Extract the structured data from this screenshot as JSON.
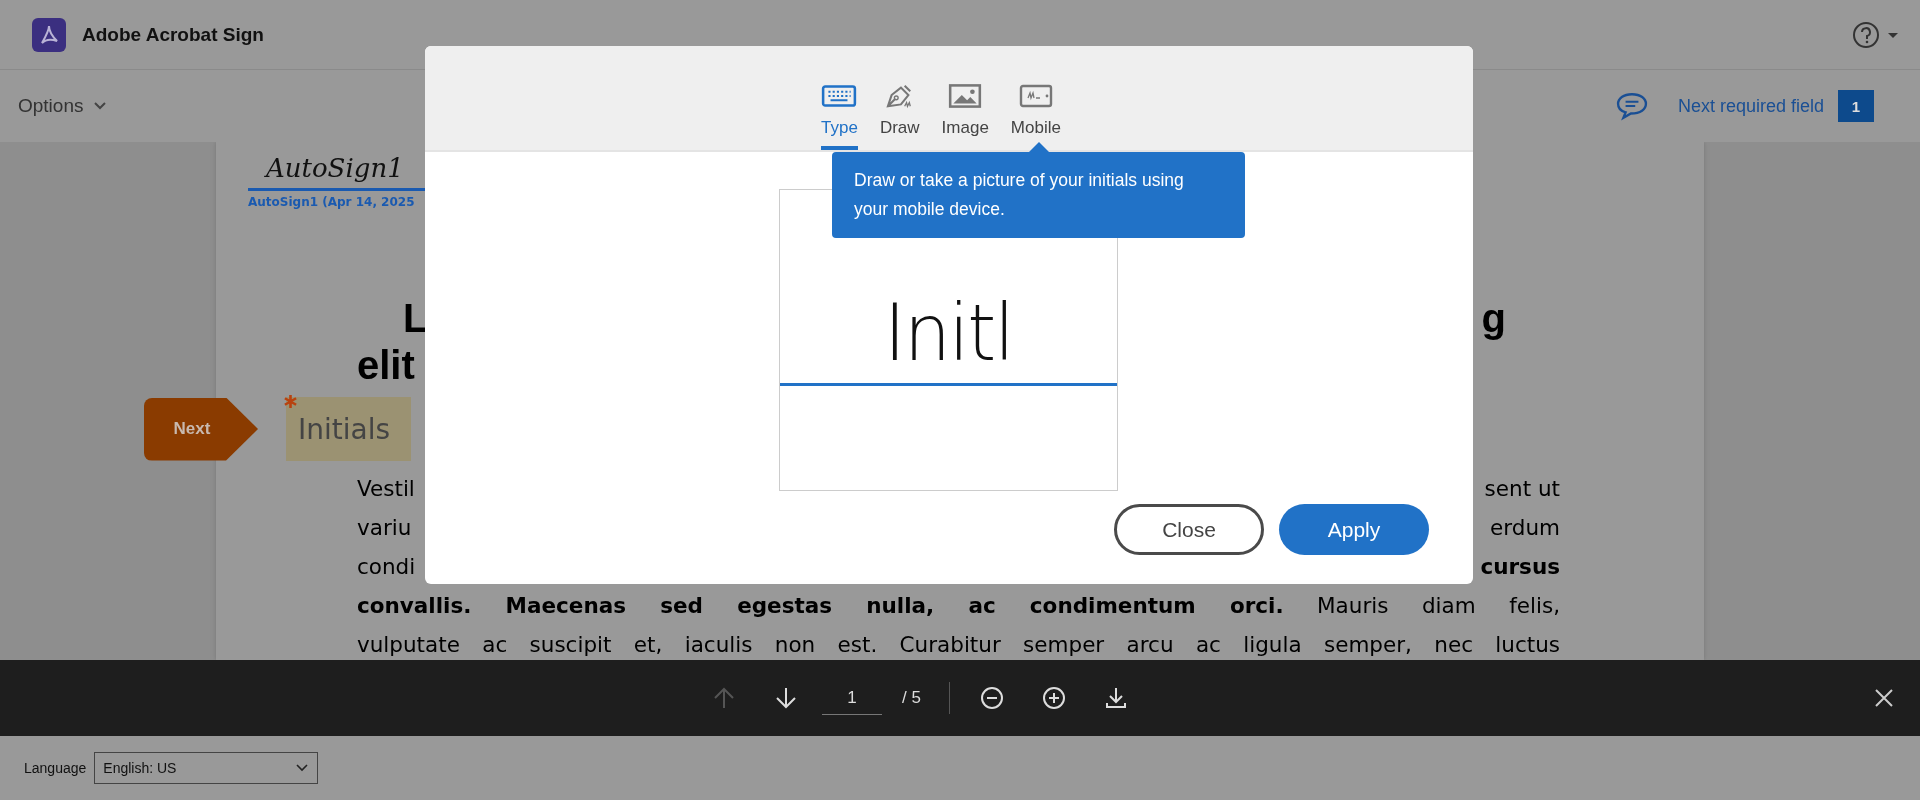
{
  "app": {
    "title": "Adobe Acrobat Sign"
  },
  "toolbar": {
    "options_label": "Options",
    "next_required_label": "Next required field",
    "required_count": "1"
  },
  "document": {
    "signature": {
      "signed_name": "AutoSign1",
      "caption": "AutoSign1 (Apr 14, 2025"
    },
    "heading_lines": [
      {
        "left": "L",
        "right": "g"
      },
      {
        "left": "elit"
      }
    ],
    "next_button": "Next",
    "initials_field": {
      "placeholder": "Initials",
      "required": true
    },
    "paragraph_lines": [
      {
        "left": "Vestil",
        "right": "sent ut"
      },
      {
        "left": "variu",
        "right": "erdum"
      },
      {
        "left": "condi",
        "right": "**cursus**"
      },
      {
        "text": "**convallis. Maecenas sed egestas nulla, ac condimentum orci.** Mauris diam felis,"
      },
      {
        "text": "vulputate ac suscipit et, iaculis non est. Curabitur semper arcu ac ligula semper, nec luctus"
      }
    ]
  },
  "dialog": {
    "tabs": [
      {
        "label": "Type",
        "selected": true
      },
      {
        "label": "Draw",
        "selected": false
      },
      {
        "label": "Image",
        "selected": false
      },
      {
        "label": "Mobile",
        "selected": false
      }
    ],
    "tooltip": "Draw or take a picture of your initials using your mobile device.",
    "initials_value": "Initl",
    "buttons": [
      {
        "label": "Close",
        "kind": "secondary"
      },
      {
        "label": "Apply",
        "kind": "primary"
      }
    ]
  },
  "pager": {
    "previous_disabled": true,
    "page": "1",
    "total": "/ 5"
  },
  "footer": {
    "language_label": "Language",
    "language_value": "English: US"
  }
}
